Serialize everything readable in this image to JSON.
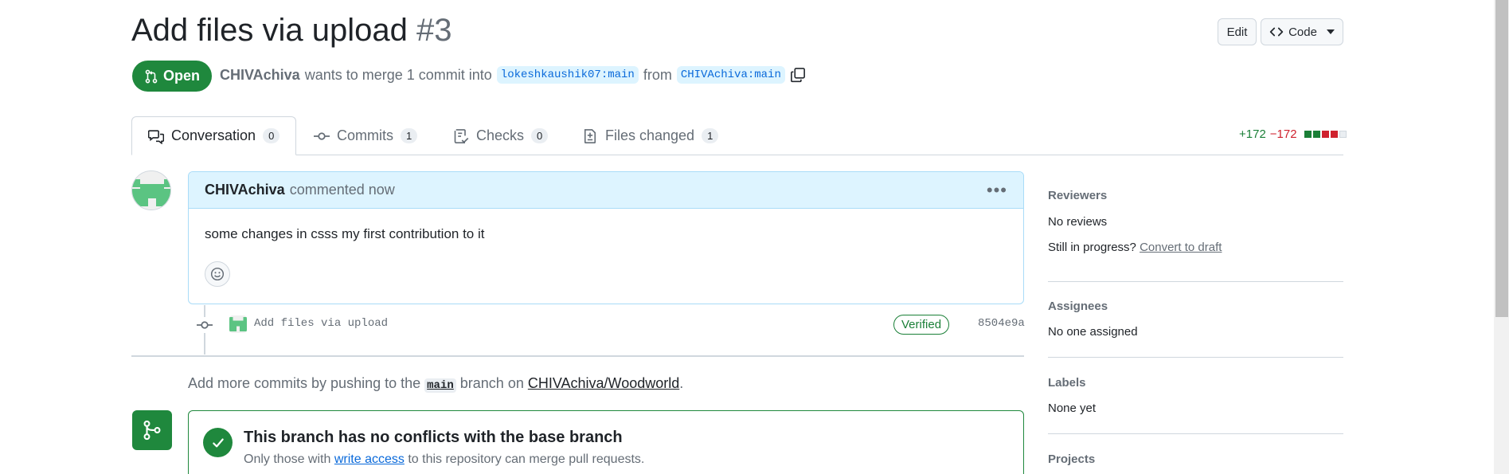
{
  "header": {
    "title": "Add files via upload",
    "number": "#3",
    "edit_label": "Edit",
    "code_label": "Code"
  },
  "state": {
    "label": "Open",
    "author": "CHIVAchiva",
    "text_before": "wants to merge 1 commit into",
    "base_branch": "lokeshkaushik07:main",
    "text_from": "from",
    "head_branch": "CHIVAchiva:main"
  },
  "tabs": [
    {
      "label": "Conversation",
      "count": "0"
    },
    {
      "label": "Commits",
      "count": "1"
    },
    {
      "label": "Checks",
      "count": "0"
    },
    {
      "label": "Files changed",
      "count": "1"
    }
  ],
  "diffstat": {
    "additions": "+172",
    "deletions": "−172",
    "colors": [
      "#1a7f37",
      "#1a7f37",
      "#cf222e",
      "#cf222e",
      "#eaeef2"
    ]
  },
  "comment": {
    "author": "CHIVAchiva",
    "action": "commented now",
    "body": "some changes in csss my first contribution to it",
    "menu_icon": "kebab-horizontal-icon"
  },
  "commit": {
    "message": "Add files via upload",
    "verified_label": "Verified",
    "sha": "8504e9a"
  },
  "hint": {
    "before": "Add more commits by pushing to the",
    "branch": "main",
    "middle": "branch on",
    "repo": "CHIVAchiva/Woodworld",
    "after": "."
  },
  "merge": {
    "title": "This branch has no conflicts with the base branch",
    "sub_before": "Only those with",
    "sub_link": "write access",
    "sub_after": "to this repository can merge pull requests."
  },
  "sidebar": {
    "reviewers_heading": "Reviewers",
    "reviewers_value": "No reviews",
    "in_progress_text": "Still in progress?",
    "convert_link": "Convert to draft",
    "assignees_heading": "Assignees",
    "assignees_value": "No one assigned",
    "labels_heading": "Labels",
    "labels_value": "None yet",
    "projects_heading": "Projects"
  },
  "colors": {
    "open_green": "#1f883d",
    "link_blue": "#0969da",
    "comment_header_bg": "#ddf4ff"
  }
}
